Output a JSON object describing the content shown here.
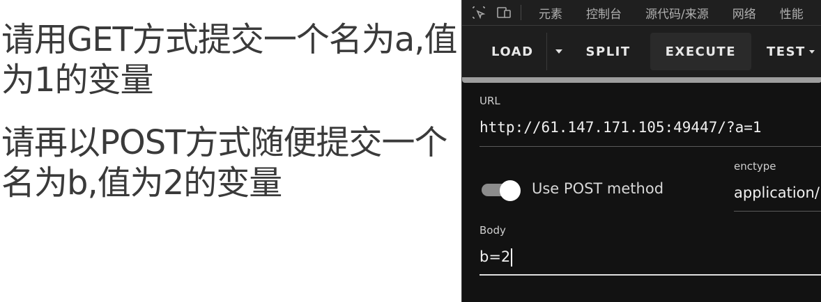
{
  "webpage": {
    "line1": "请用GET方式提交一个名为a,值为1的变量",
    "line2": "请再以POST方式随便提交一个名为b,值为2的变量"
  },
  "devtools": {
    "tabs": [
      "元素",
      "控制台",
      "源代码/来源",
      "网络",
      "性能"
    ],
    "icons": [
      "inspect-element-icon",
      "device-toolbar-icon"
    ]
  },
  "hackbar": {
    "toolbar": {
      "load": "LOAD",
      "split": "SPLIT",
      "execute": "EXECUTE",
      "test": "TEST"
    },
    "url": {
      "label": "URL",
      "value": "http://61.147.171.105:49447/?a=1"
    },
    "post": {
      "label": "Use POST method",
      "enabled": true
    },
    "enctype": {
      "label": "enctype",
      "value": "application/"
    },
    "body": {
      "label": "Body",
      "value": "b=2"
    }
  },
  "colors": {
    "page_background": "#ffffff",
    "page_text": "#3a3a3a",
    "devtools_background": "#121212",
    "toolbar_background": "#1e1e1e"
  }
}
